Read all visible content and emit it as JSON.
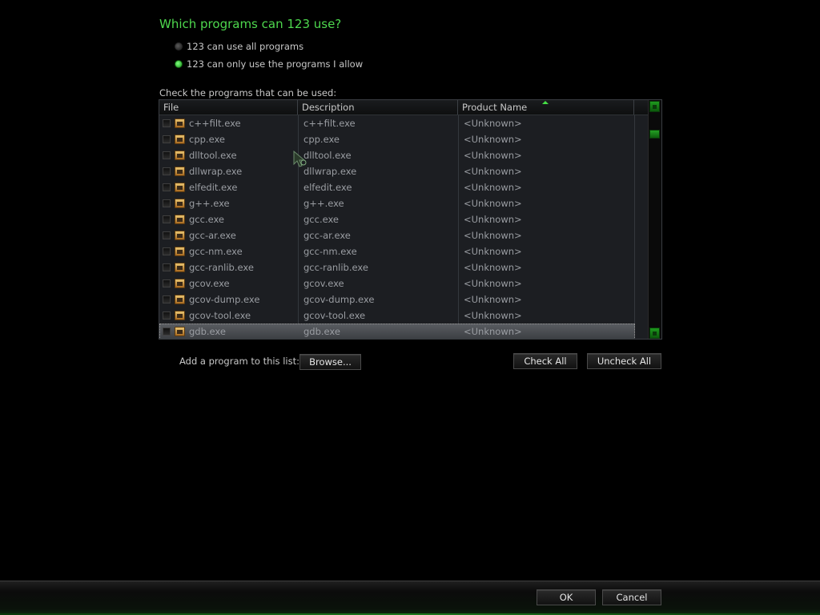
{
  "title": "Which programs can 123 use?",
  "options": {
    "all_label": "123 can use all programs",
    "allow_label": "123 can only use the programs I allow",
    "selected": "allow"
  },
  "instruction": "Check the programs that can be used:",
  "columns": {
    "file": "File",
    "description": "Description",
    "product": "Product Name"
  },
  "rows": [
    {
      "file": "c++filt.exe",
      "description": "c++filt.exe",
      "product": "<Unknown>",
      "checked": false
    },
    {
      "file": "cpp.exe",
      "description": "cpp.exe",
      "product": "<Unknown>",
      "checked": false
    },
    {
      "file": "dlltool.exe",
      "description": "dlltool.exe",
      "product": "<Unknown>",
      "checked": false
    },
    {
      "file": "dllwrap.exe",
      "description": "dllwrap.exe",
      "product": "<Unknown>",
      "checked": false
    },
    {
      "file": "elfedit.exe",
      "description": "elfedit.exe",
      "product": "<Unknown>",
      "checked": false
    },
    {
      "file": "g++.exe",
      "description": "g++.exe",
      "product": "<Unknown>",
      "checked": false
    },
    {
      "file": "gcc.exe",
      "description": "gcc.exe",
      "product": "<Unknown>",
      "checked": false
    },
    {
      "file": "gcc-ar.exe",
      "description": "gcc-ar.exe",
      "product": "<Unknown>",
      "checked": false
    },
    {
      "file": "gcc-nm.exe",
      "description": "gcc-nm.exe",
      "product": "<Unknown>",
      "checked": false
    },
    {
      "file": "gcc-ranlib.exe",
      "description": "gcc-ranlib.exe",
      "product": "<Unknown>",
      "checked": false
    },
    {
      "file": "gcov.exe",
      "description": "gcov.exe",
      "product": "<Unknown>",
      "checked": false
    },
    {
      "file": "gcov-dump.exe",
      "description": "gcov-dump.exe",
      "product": "<Unknown>",
      "checked": false
    },
    {
      "file": "gcov-tool.exe",
      "description": "gcov-tool.exe",
      "product": "<Unknown>",
      "checked": false
    },
    {
      "file": "gdb.exe",
      "description": "gdb.exe",
      "product": "<Unknown>",
      "checked": false,
      "selected": true
    }
  ],
  "add_program": {
    "label": "Add a program to this list:",
    "browse": "Browse..."
  },
  "check_all": "Check All",
  "uncheck_all": "Uncheck All",
  "footer": {
    "ok": "OK",
    "cancel": "Cancel"
  },
  "colors": {
    "accent": "#4ed84e",
    "background": "#000000",
    "list_background": "#1c1e22"
  },
  "icons": {
    "row_icon": "exe-file-icon",
    "scroll_up": "scroll-up-icon",
    "scroll_down": "scroll-down-icon"
  }
}
